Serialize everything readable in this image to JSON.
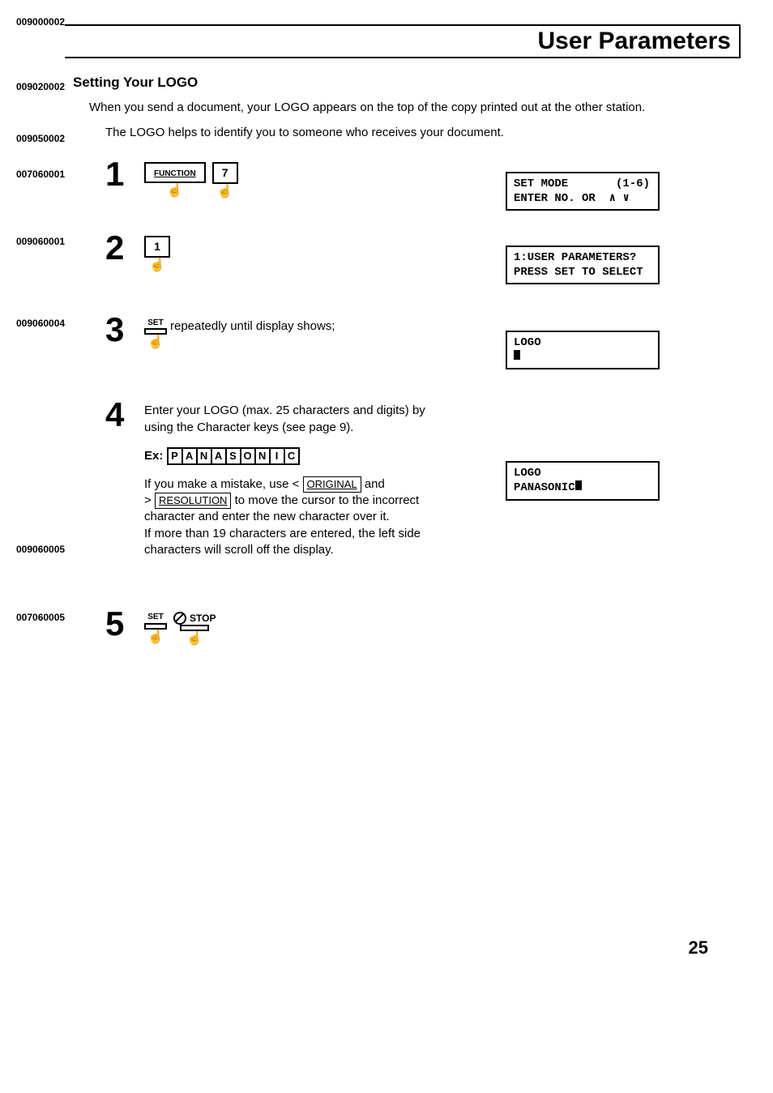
{
  "page": {
    "title": "User Parameters",
    "number": "25"
  },
  "codes": {
    "top": "009000002",
    "section": "009020002",
    "intro2": "009050002",
    "step1": "007060001",
    "step2": "009060001",
    "step3": "009060004",
    "step4b": "009060005",
    "step5": "007060005"
  },
  "section": {
    "heading": "Setting Your LOGO",
    "intro_line1": "When you send a document, your LOGO appears on the top of the copy printed out at the other station.",
    "intro_line2": "The LOGO helps to identify you to someone who receives your document."
  },
  "steps": {
    "s1": {
      "num": "1",
      "function_label": "FUNCTION",
      "key7": "7",
      "display": "SET MODE       (1-6)\nENTER NO. OR  ∧ ∨"
    },
    "s2": {
      "num": "2",
      "key1": "1",
      "display": "1:USER PARAMETERS?\nPRESS SET TO SELECT"
    },
    "s3": {
      "num": "3",
      "set_label": "SET",
      "text_after": " repeatedly until display shows;",
      "display": "LOGO\n▮"
    },
    "s4": {
      "num": "4",
      "text1": "Enter your LOGO (max. 25 characters and digits) by using the Character keys (see page 9).",
      "ex_label": "Ex:",
      "example_chars": [
        "P",
        "A",
        "N",
        "A",
        "S",
        "O",
        "N",
        "I",
        "C"
      ],
      "text2a": "If you make a mistake, use < ",
      "original_key": "ORIGINAL",
      "text2b": " and",
      "text2c": "> ",
      "resolution_key": "RESOLUTION",
      "text2d": " to move the cursor to the incorrect character and enter the new character over it.",
      "text3": "If more than 19 characters are entered, the left side characters will scroll off the display.",
      "display": "LOGO\nPANASONIC▮"
    },
    "s5": {
      "num": "5",
      "set_label": "SET",
      "stop_label": "STOP"
    }
  }
}
